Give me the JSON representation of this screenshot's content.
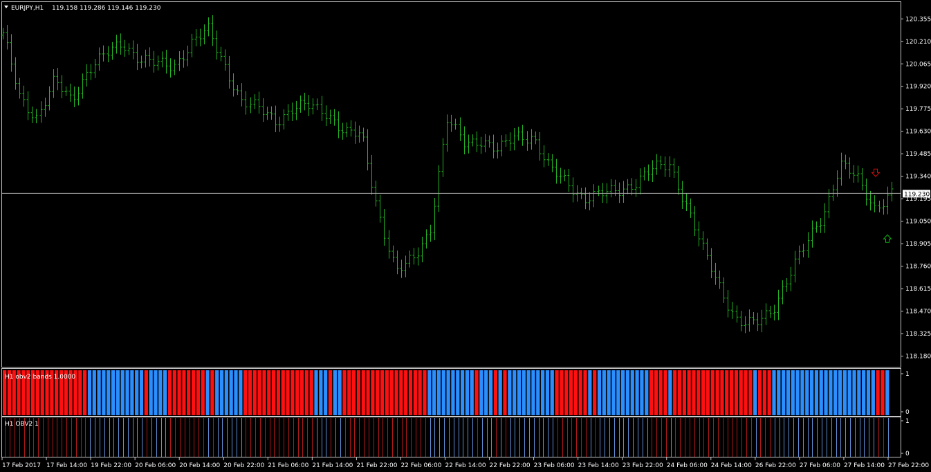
{
  "header": {
    "symbol": "EURJPY,H1",
    "ohlc": "119.158 119.286 119.146 119.230"
  },
  "colors": {
    "background": "#000000",
    "frame": "#c8c8c8",
    "bar": "#22b522",
    "current_price_line": "#a8a8a8",
    "current_price_tag_bg": "#ffffff",
    "bear_band": "#ff1010",
    "bull_band": "#2a8eff",
    "sell_arrow": "#d01010",
    "buy_arrow": "#10b010"
  },
  "icons": {
    "menu": "triangle-down-icon",
    "sell": "down-arrow-icon",
    "buy": "up-arrow-icon"
  },
  "chart_data": [
    {
      "type": "ohlc",
      "title": "EURJPY,H1",
      "ylim": [
        118.12,
        120.45
      ],
      "y_ticks": [
        "120.355",
        "120.210",
        "120.065",
        "119.920",
        "119.775",
        "119.630",
        "119.485",
        "119.340",
        "119.195",
        "119.050",
        "118.905",
        "118.760",
        "118.615",
        "118.470",
        "118.325",
        "118.180"
      ],
      "current_price": "119.230",
      "x_ticks": [
        "17 Feb 2017",
        "17 Feb 14:00",
        "19 Feb 22:00",
        "20 Feb 06:00",
        "20 Feb 14:00",
        "20 Feb 22:00",
        "21 Feb 06:00",
        "21 Feb 14:00",
        "21 Feb 22:00",
        "22 Feb 06:00",
        "22 Feb 14:00",
        "22 Feb 22:00",
        "23 Feb 06:00",
        "23 Feb 14:00",
        "23 Feb 22:00",
        "24 Feb 06:00",
        "24 Feb 14:00",
        "26 Feb 22:00",
        "27 Feb 06:00",
        "27 Feb 14:00",
        "27 Feb 22:00"
      ],
      "close_path": [
        120.25,
        119.85,
        119.72,
        119.95,
        119.83,
        120.03,
        120.12,
        120.2,
        120.1,
        120.06,
        120.05,
        120.2,
        120.28,
        120.05,
        119.82,
        119.77,
        119.7,
        119.78,
        119.79,
        119.75,
        119.62,
        119.6,
        119.1,
        118.72,
        118.8,
        119.0,
        119.7,
        119.55,
        119.58,
        119.5,
        119.6,
        119.6,
        119.38,
        119.3,
        119.2,
        119.22,
        119.25,
        119.3,
        119.38,
        119.42,
        119.15,
        118.85,
        118.62,
        118.4,
        118.38,
        118.48,
        118.7,
        118.9,
        119.1,
        119.42,
        119.32,
        119.14,
        119.23
      ],
      "signals": [
        {
          "type": "sell",
          "price": 119.36
        },
        {
          "type": "buy",
          "price": 118.94
        }
      ]
    },
    {
      "type": "bar",
      "title": "H1 obv2 bands 1.0000",
      "ylim": [
        0,
        1
      ],
      "y_ticks": [
        "1",
        "0"
      ],
      "bands": [
        {
          "color": "red",
          "count": 18
        },
        {
          "color": "blue",
          "count": 12
        },
        {
          "color": "red",
          "count": 1
        },
        {
          "color": "blue",
          "count": 4
        },
        {
          "color": "red",
          "count": 8
        },
        {
          "color": "blue",
          "count": 1
        },
        {
          "color": "red",
          "count": 1
        },
        {
          "color": "blue",
          "count": 6
        },
        {
          "color": "red",
          "count": 15
        },
        {
          "color": "blue",
          "count": 3
        },
        {
          "color": "red",
          "count": 1
        },
        {
          "color": "blue",
          "count": 2
        },
        {
          "color": "red",
          "count": 18
        },
        {
          "color": "blue",
          "count": 10
        },
        {
          "color": "red",
          "count": 1
        },
        {
          "color": "blue",
          "count": 3
        },
        {
          "color": "red",
          "count": 1
        },
        {
          "color": "blue",
          "count": 1
        },
        {
          "color": "red",
          "count": 1
        },
        {
          "color": "blue",
          "count": 10
        },
        {
          "color": "red",
          "count": 7
        },
        {
          "color": "blue",
          "count": 1
        },
        {
          "color": "red",
          "count": 1
        },
        {
          "color": "blue",
          "count": 11
        },
        {
          "color": "red",
          "count": 4
        },
        {
          "color": "blue",
          "count": 1
        },
        {
          "color": "red",
          "count": 17
        },
        {
          "color": "blue",
          "count": 1
        },
        {
          "color": "red",
          "count": 3
        },
        {
          "color": "blue",
          "count": 22
        },
        {
          "color": "red",
          "count": 2
        },
        {
          "color": "blue",
          "count": 1
        }
      ]
    },
    {
      "type": "bar",
      "title": "H1 OBV2 1",
      "ylim": [
        0,
        1
      ],
      "y_ticks": [
        "1",
        "0"
      ]
    }
  ]
}
